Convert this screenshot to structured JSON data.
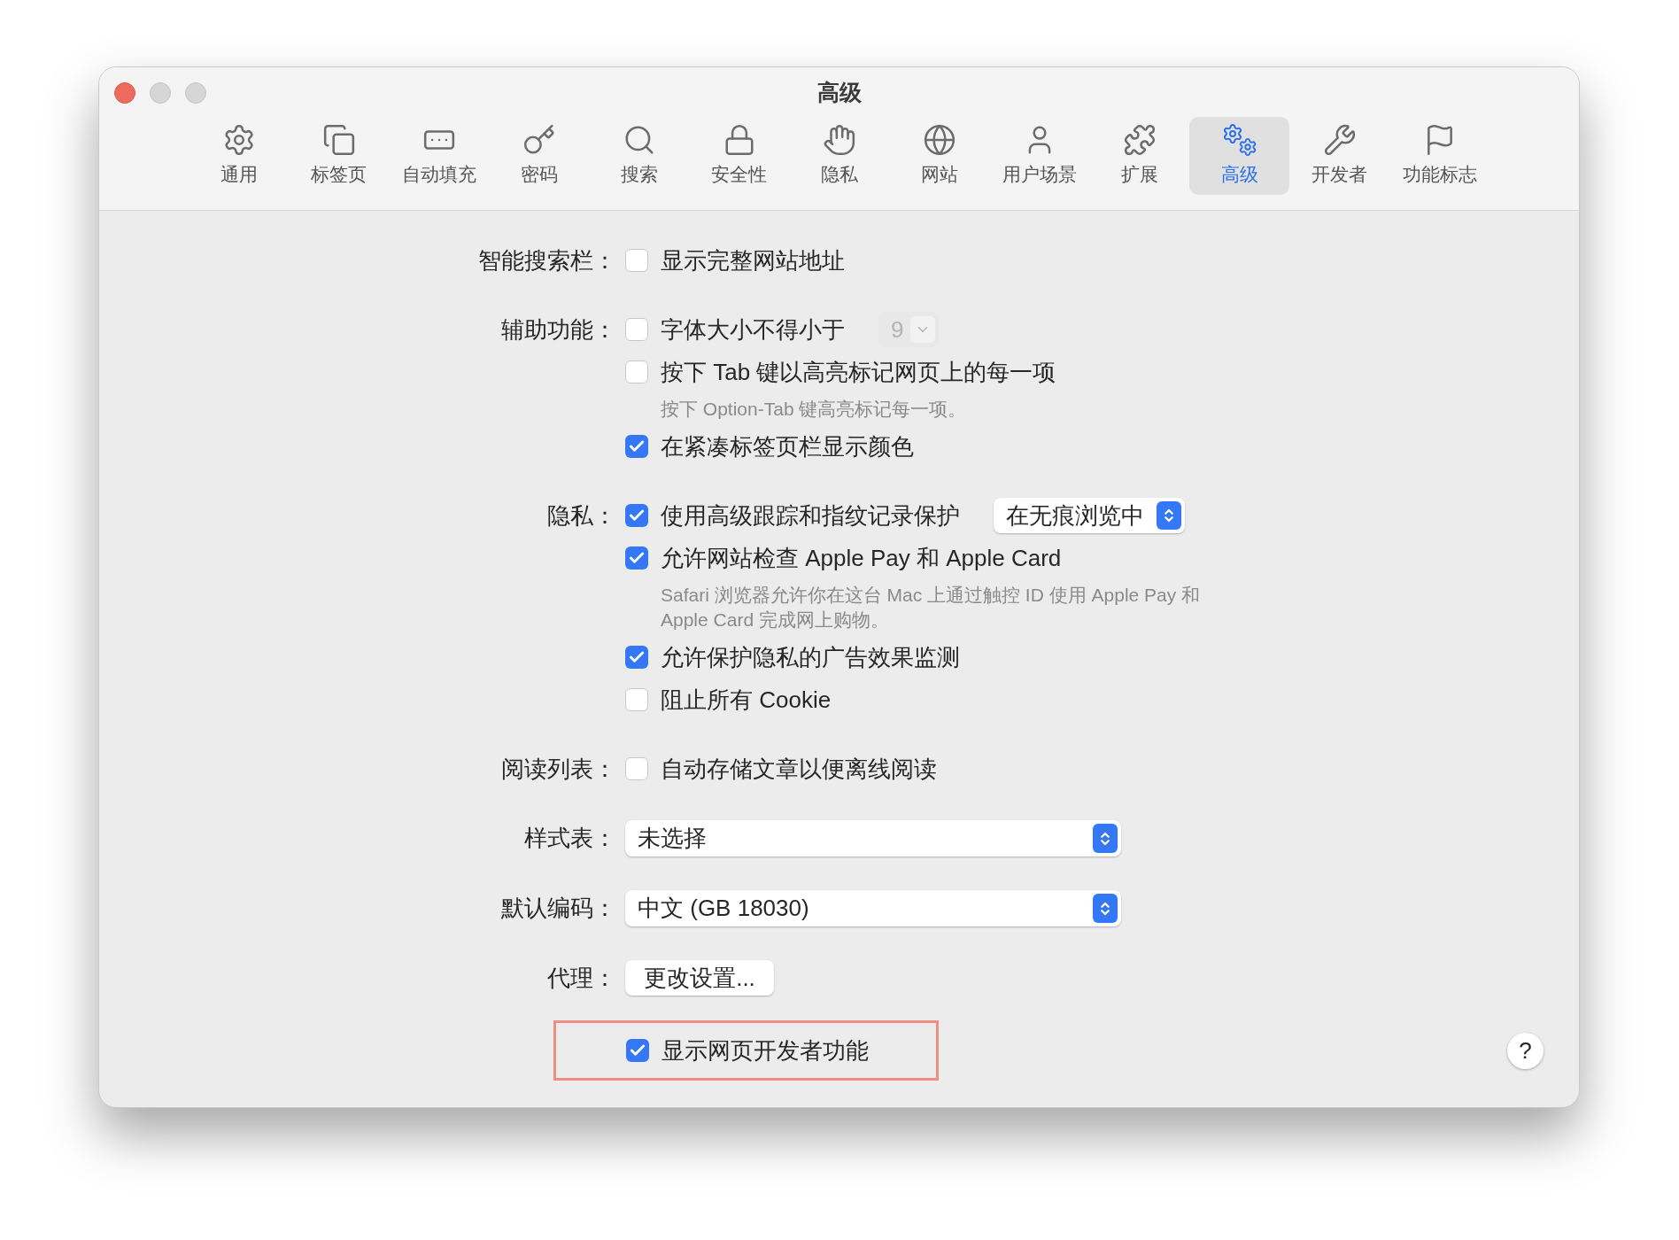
{
  "window": {
    "title": "高级"
  },
  "toolbar": [
    {
      "label": "通用",
      "selected": false
    },
    {
      "label": "标签页",
      "selected": false
    },
    {
      "label": "自动填充",
      "selected": false
    },
    {
      "label": "密码",
      "selected": false
    },
    {
      "label": "搜索",
      "selected": false
    },
    {
      "label": "安全性",
      "selected": false
    },
    {
      "label": "隐私",
      "selected": false
    },
    {
      "label": "网站",
      "selected": false
    },
    {
      "label": "用户场景",
      "selected": false
    },
    {
      "label": "扩展",
      "selected": false
    },
    {
      "label": "高级",
      "selected": true
    },
    {
      "label": "开发者",
      "selected": false
    },
    {
      "label": "功能标志",
      "selected": false
    }
  ],
  "sections": [
    {
      "label": "智能搜索栏：",
      "items": [
        {
          "kind": "checkbox",
          "label": "显示完整网站地址",
          "checked": false
        }
      ]
    },
    {
      "label": "辅助功能：",
      "items": [
        {
          "kind": "checkbox",
          "label": "字体大小不得小于",
          "checked": false,
          "stepper": {
            "value": "9",
            "disabled": true
          }
        },
        {
          "kind": "checkbox",
          "label": "按下 Tab 键以高亮标记网页上的每一项",
          "checked": false
        },
        {
          "kind": "hint",
          "text": "按下 Option-Tab 键高亮标记每一项。"
        },
        {
          "kind": "checkbox",
          "label": "在紧凑标签页栏显示颜色",
          "checked": true
        }
      ]
    },
    {
      "label": "隐私：",
      "items": [
        {
          "kind": "checkbox",
          "label": "使用高级跟踪和指纹记录保护",
          "checked": true,
          "popup": "在无痕浏览中"
        },
        {
          "kind": "checkbox",
          "label": "允许网站检查 Apple Pay 和 Apple Card",
          "checked": true
        },
        {
          "kind": "hint",
          "text": "Safari 浏览器允许你在这台 Mac 上通过触控 ID 使用 Apple Pay 和 Apple Card 完成网上购物。"
        },
        {
          "kind": "checkbox",
          "label": "允许保护隐私的广告效果监测",
          "checked": true
        },
        {
          "kind": "checkbox",
          "label": "阻止所有 Cookie",
          "checked": false
        }
      ]
    },
    {
      "label": "阅读列表：",
      "items": [
        {
          "kind": "checkbox",
          "label": "自动存储文章以便离线阅读",
          "checked": false
        }
      ]
    },
    {
      "label": "样式表：",
      "items": [
        {
          "kind": "select",
          "value": "未选择"
        }
      ]
    },
    {
      "label": "默认编码：",
      "items": [
        {
          "kind": "select",
          "value": "中文 (GB 18030)"
        }
      ]
    },
    {
      "label": "代理：",
      "items": [
        {
          "kind": "button",
          "label": "更改设置..."
        }
      ]
    }
  ],
  "developer": {
    "label": "显示网页开发者功能",
    "checked": true,
    "highlighted": true
  },
  "help": "?"
}
